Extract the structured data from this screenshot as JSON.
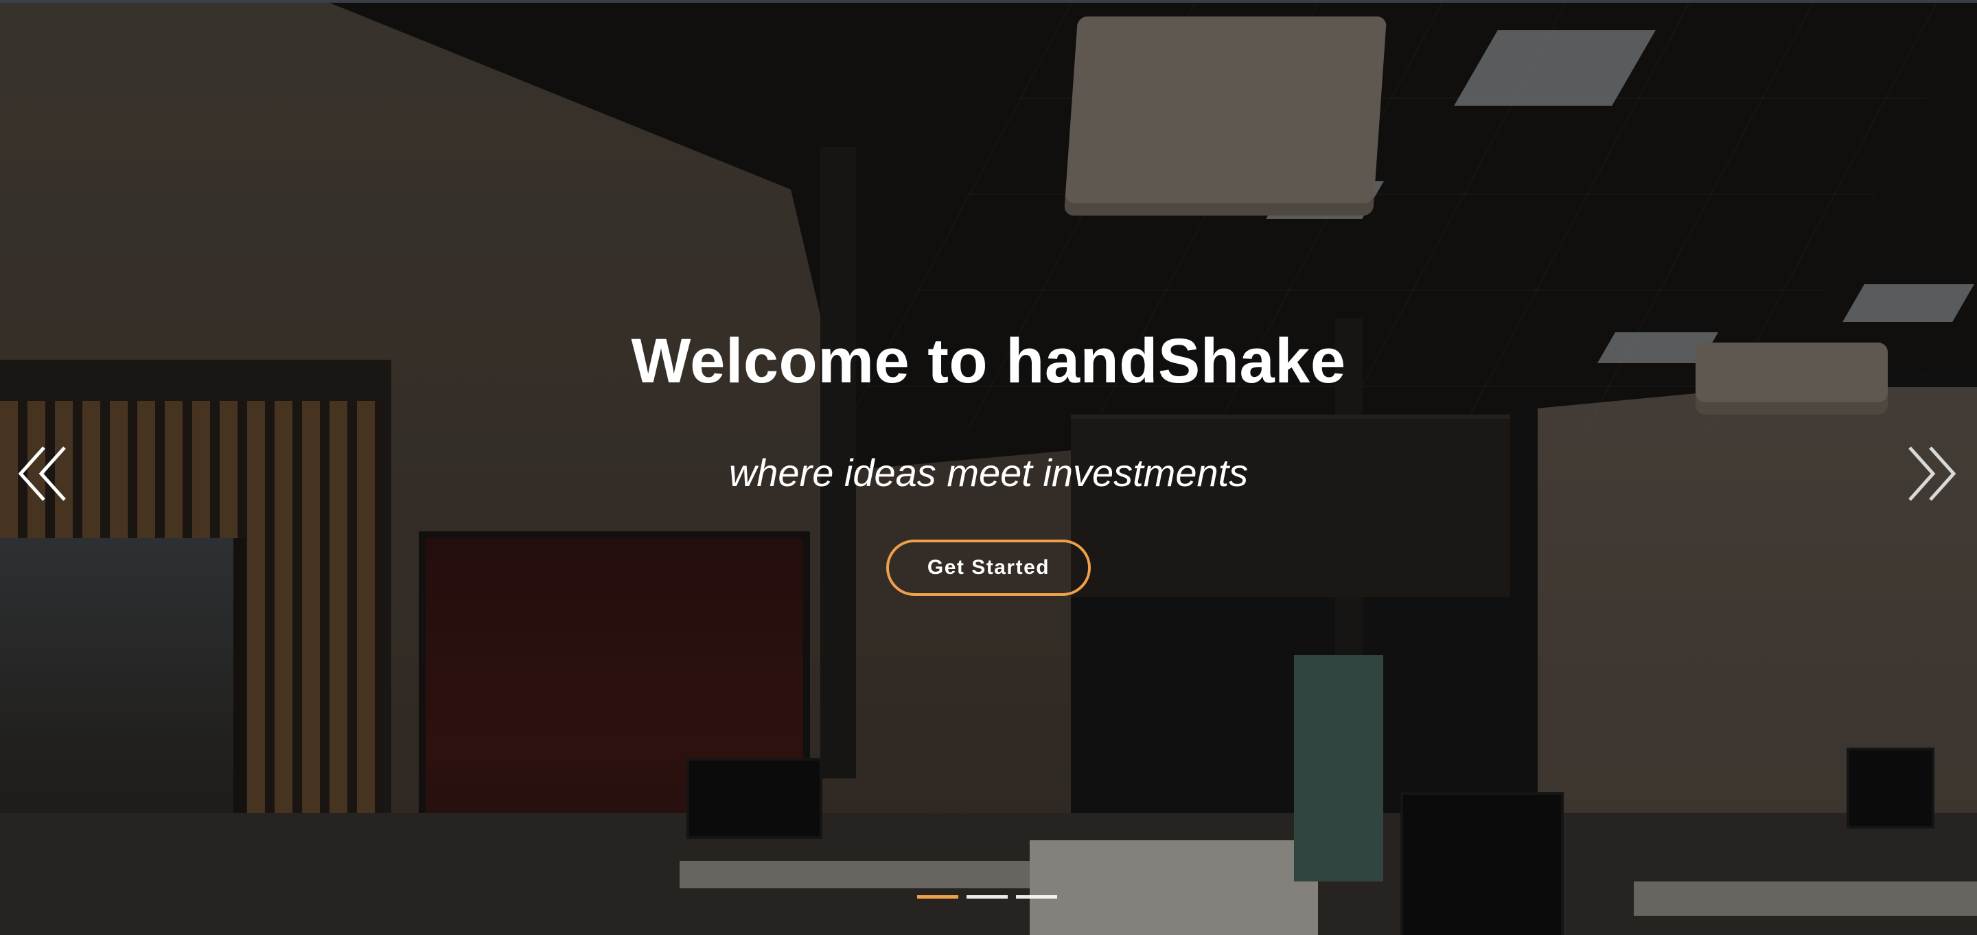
{
  "hero": {
    "title": "Welcome to handShake",
    "subtitle": "where ideas meet investments",
    "cta_label": "Get Started"
  },
  "carousel": {
    "prev_icon": "chevron-double-left-icon",
    "next_icon": "chevron-double-right-icon",
    "slide_count": 3,
    "active_index": 0
  },
  "colors": {
    "accent": "#f0a04b",
    "text": "#ffffff",
    "overlay": "rgba(0,0,0,0.38)"
  }
}
